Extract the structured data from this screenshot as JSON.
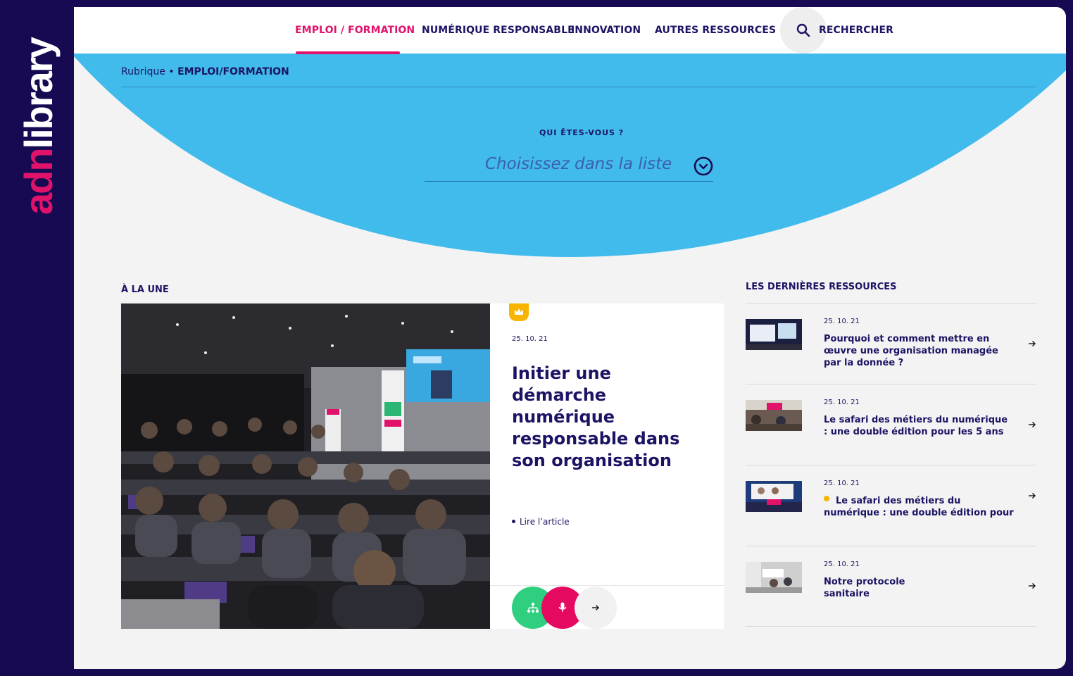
{
  "brand": {
    "logo_text": "adnlibrary",
    "primary_color": "#170a52",
    "accent_color": "#e0126a",
    "sky_color": "#41baec"
  },
  "nav": {
    "items": [
      {
        "label": "EMPLOI / FORMATION",
        "active": true
      },
      {
        "label": "NUMÉRIQUE RESPONSABLE",
        "active": false
      },
      {
        "label": "INNOVATION",
        "active": false
      },
      {
        "label": "AUTRES RESSOURCES",
        "active": false
      }
    ],
    "search_label": "RECHERCHER",
    "search_icon": "search-icon"
  },
  "breadcrumb": {
    "root": "Rubrique",
    "separator": "•",
    "current": "EMPLOI/FORMATION"
  },
  "filter": {
    "label": "QUI ÊTES-VOUS ?",
    "placeholder": "Choisissez dans la liste",
    "icon": "chevron-down-circle-icon"
  },
  "featured": {
    "section_title": "À LA UNE",
    "badge_icon": "crown-icon",
    "date": "25. 10. 21",
    "title": "Initier une démarche numérique responsable dans son organisation",
    "read_label": "Lire l’article",
    "action_icons": [
      "sitemap-icon",
      "microphone-icon",
      "arrow-right-icon"
    ],
    "action_colors": [
      "#2fcf7f",
      "#e5095f",
      "#f1f1f1"
    ]
  },
  "latest": {
    "section_title": "LES DERNIÈRES RESSOURCES",
    "items": [
      {
        "date": "25. 10. 21",
        "title": "Pourquoi et comment mettre en œuvre une organisation managée par la donnée ?",
        "dot": false
      },
      {
        "date": "25. 10. 21",
        "title": "Le safari des métiers du numérique : une double édition pour les 5 ans",
        "dot": false
      },
      {
        "date": "25. 10. 21",
        "title": "Le safari des métiers du numérique : une double édition pour",
        "dot": true
      },
      {
        "date": "25. 10. 21",
        "title": "Notre protocole sanitaire",
        "dot": false
      }
    ]
  }
}
